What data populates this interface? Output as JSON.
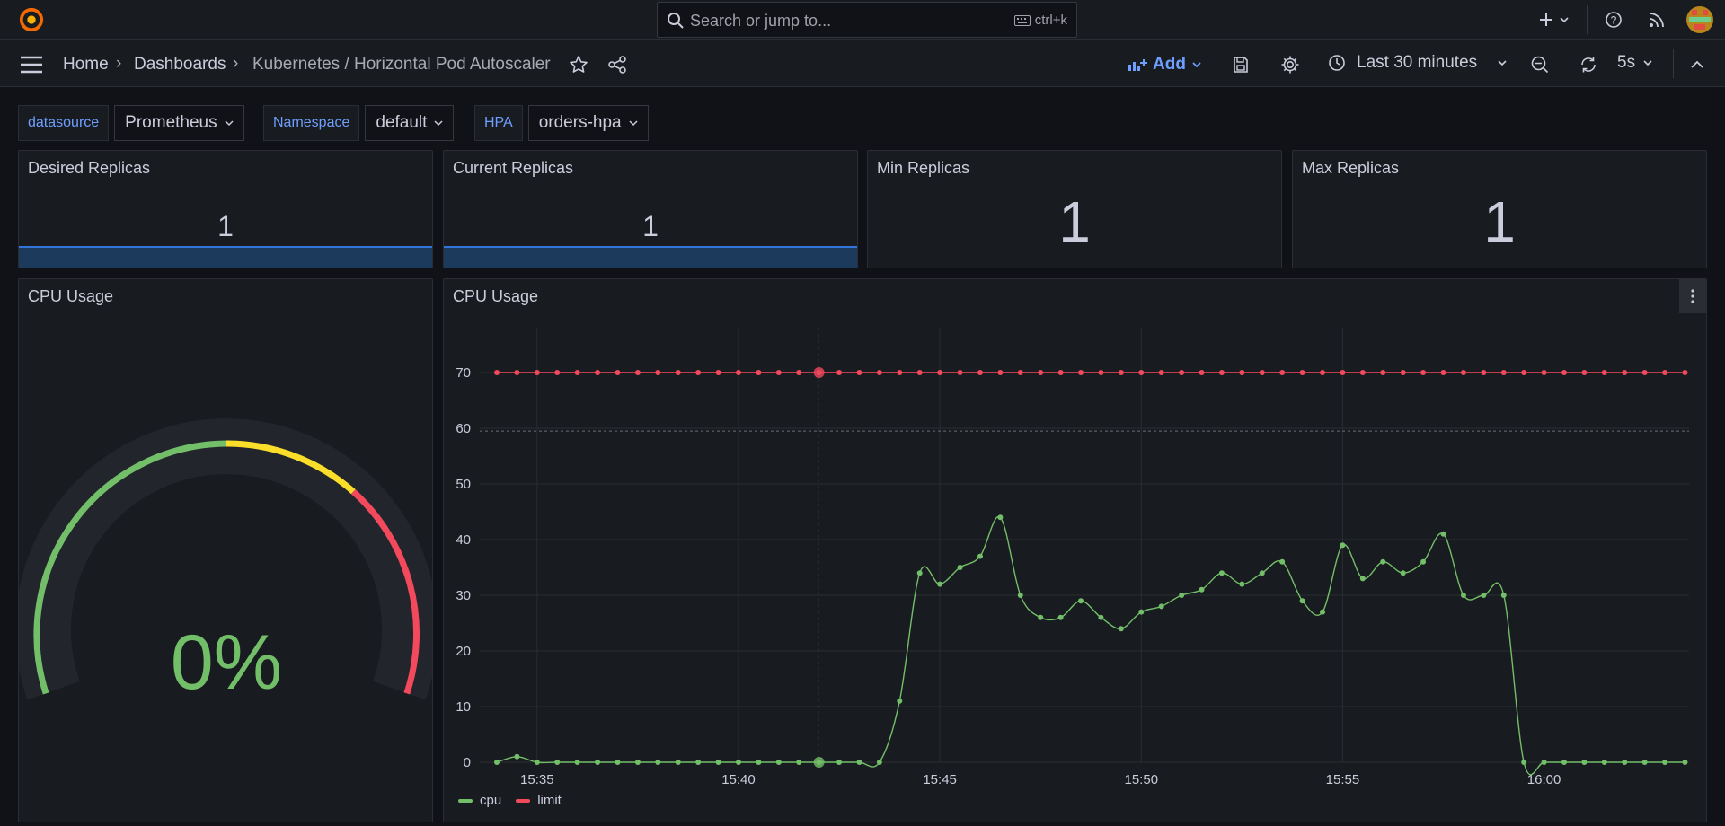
{
  "app": {
    "name": "Grafana"
  },
  "search": {
    "placeholder": "Search or jump to...",
    "shortcut": "ctrl+k"
  },
  "breadcrumb": {
    "home": "Home",
    "dashboards": "Dashboards",
    "current": "Kubernetes / Horizontal Pod Autoscaler"
  },
  "toolbar": {
    "add_label": "Add",
    "time_range": "Last 30 minutes",
    "refresh_interval": "5s"
  },
  "variables": [
    {
      "label": "datasource",
      "value": "Prometheus"
    },
    {
      "label": "Namespace",
      "value": "default"
    },
    {
      "label": "HPA",
      "value": "orders-hpa"
    }
  ],
  "stats": {
    "desired": {
      "title": "Desired Replicas",
      "value": "1"
    },
    "current": {
      "title": "Current Replicas",
      "value": "1"
    },
    "min": {
      "title": "Min Replicas",
      "value": "1"
    },
    "max": {
      "title": "Max Replicas",
      "value": "1"
    }
  },
  "gauge": {
    "title": "CPU Usage",
    "value": "0%",
    "value_fraction": 0,
    "colors": {
      "green": "#73bf69",
      "yellow": "#fade2a",
      "red": "#f2495c"
    }
  },
  "colors": {
    "accent": "#6e9fff",
    "cpu": "#73bf69",
    "limit": "#f2495c"
  },
  "timeseries": {
    "title": "CPU Usage"
  },
  "chart_data": {
    "type": "line",
    "title": "CPU Usage",
    "xlabel": "",
    "ylabel": "",
    "x_ticks": [
      "15:35",
      "15:40",
      "15:45",
      "15:50",
      "15:55",
      "16:00"
    ],
    "y_ticks": [
      0,
      10,
      20,
      30,
      40,
      50,
      60,
      70
    ],
    "ylim": [
      0,
      70
    ],
    "grid": true,
    "legend_position": "bottom-left",
    "threshold_line": 59.5,
    "x": [
      "15:34:00",
      "15:34:30",
      "15:35:00",
      "15:35:30",
      "15:36:00",
      "15:36:30",
      "15:37:00",
      "15:37:30",
      "15:38:00",
      "15:38:30",
      "15:39:00",
      "15:39:30",
      "15:40:00",
      "15:40:30",
      "15:41:00",
      "15:41:30",
      "15:42:00",
      "15:42:30",
      "15:43:00",
      "15:43:30",
      "15:44:00",
      "15:44:30",
      "15:45:00",
      "15:45:30",
      "15:46:00",
      "15:46:30",
      "15:47:00",
      "15:47:30",
      "15:48:00",
      "15:48:30",
      "15:49:00",
      "15:49:30",
      "15:50:00",
      "15:50:30",
      "15:51:00",
      "15:51:30",
      "15:52:00",
      "15:52:30",
      "15:53:00",
      "15:53:30",
      "15:54:00",
      "15:54:30",
      "15:55:00",
      "15:55:30",
      "15:56:00",
      "15:56:30",
      "15:57:00",
      "15:57:30",
      "15:58:00",
      "15:58:30",
      "15:59:00",
      "15:59:30",
      "16:00:00",
      "16:00:30",
      "16:01:00",
      "16:01:30",
      "16:02:00",
      "16:02:30",
      "16:03:00",
      "16:03:30"
    ],
    "series": [
      {
        "name": "cpu",
        "values": [
          0,
          1,
          0,
          0,
          0,
          0,
          0,
          0,
          0,
          0,
          0,
          0,
          0,
          0,
          0,
          0,
          0,
          0,
          0,
          0,
          11,
          34,
          32,
          35,
          37,
          44,
          30,
          26,
          26,
          29,
          26,
          24,
          27,
          28,
          30,
          31,
          34,
          32,
          34,
          36,
          29,
          27,
          39,
          33,
          36,
          34,
          36,
          41,
          30,
          30,
          30,
          0,
          0,
          0,
          0,
          0,
          0,
          0,
          0,
          0,
          0
        ]
      },
      {
        "name": "limit",
        "values": [
          70,
          70,
          70,
          70,
          70,
          70,
          70,
          70,
          70,
          70,
          70,
          70,
          70,
          70,
          70,
          70,
          70,
          70,
          70,
          70,
          70,
          70,
          70,
          70,
          70,
          70,
          70,
          70,
          70,
          70,
          70,
          70,
          70,
          70,
          70,
          70,
          70,
          70,
          70,
          70,
          70,
          70,
          70,
          70,
          70,
          70,
          70,
          70,
          70,
          70,
          70,
          70,
          70,
          70,
          70,
          70,
          70,
          70,
          70,
          70,
          70
        ]
      }
    ]
  }
}
